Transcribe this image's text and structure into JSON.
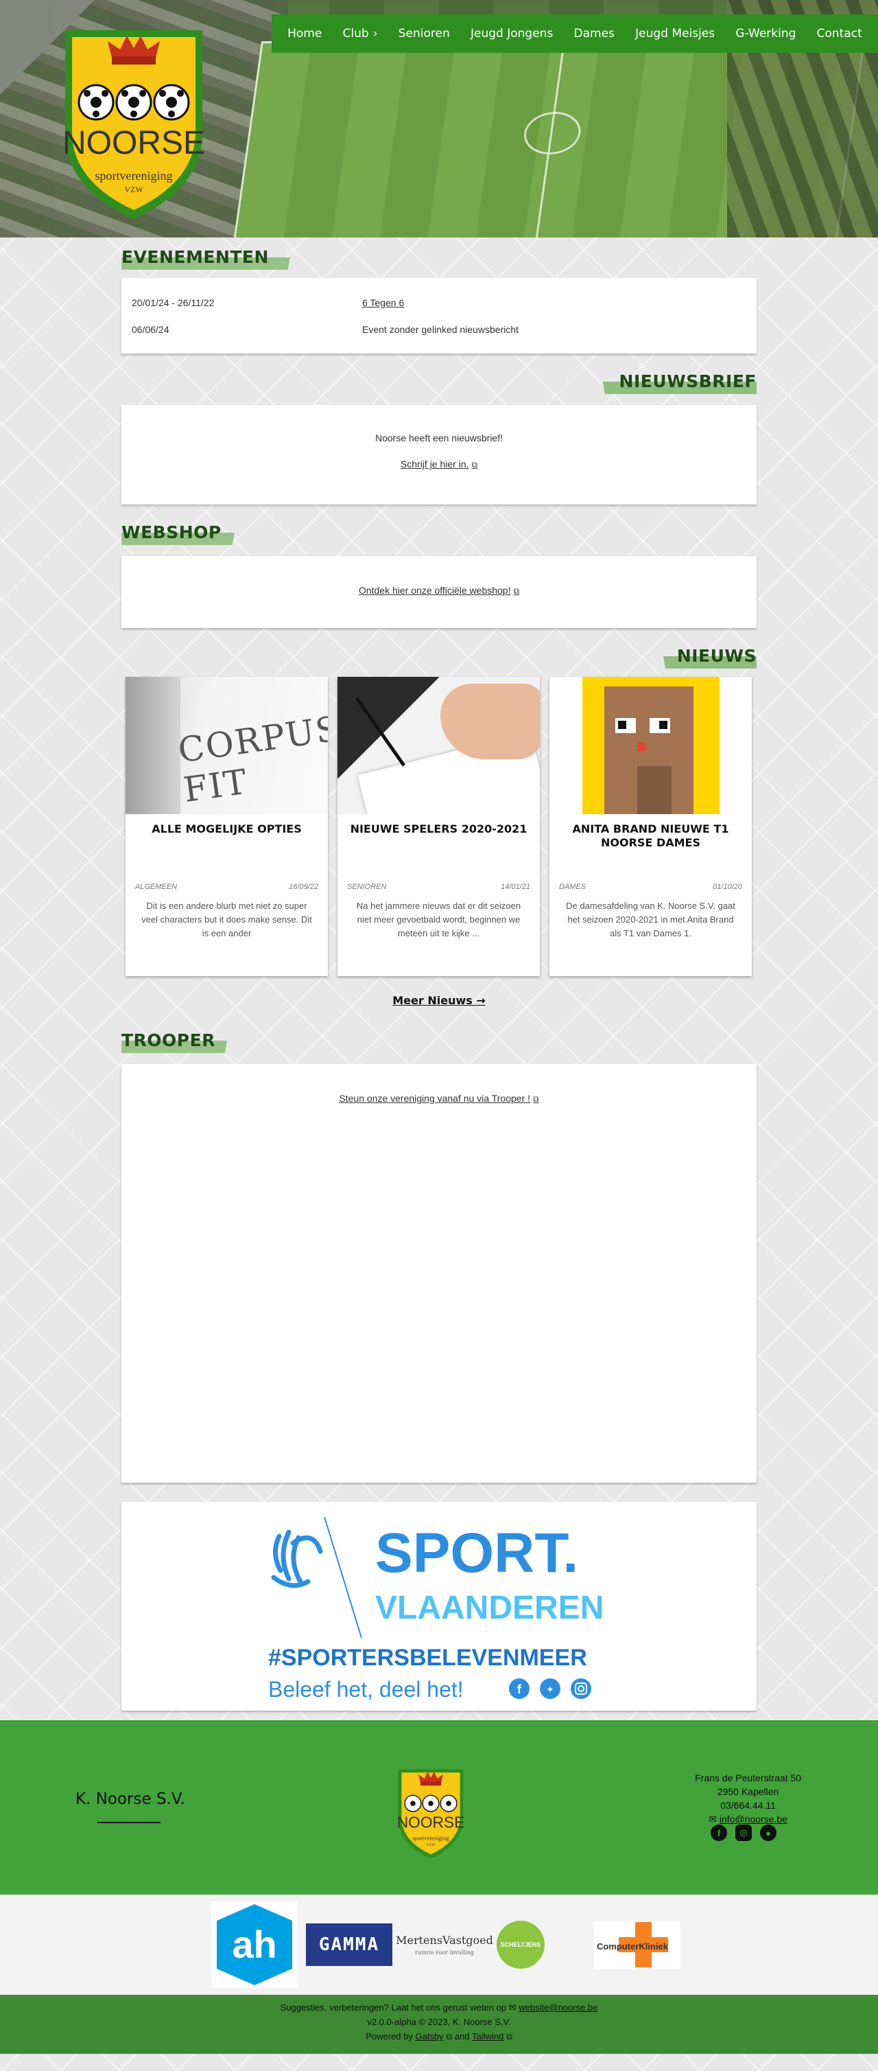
{
  "nav": {
    "items": [
      {
        "label": "Home"
      },
      {
        "label": "Club"
      },
      {
        "label": "Senioren"
      },
      {
        "label": "Jeugd Jongens"
      },
      {
        "label": "Dames"
      },
      {
        "label": "Jeugd Meisjes"
      },
      {
        "label": "G-Werking"
      },
      {
        "label": "Contact"
      }
    ]
  },
  "logo": {
    "name": "NOORSE",
    "subtitle": "sportvereniging",
    "vzw": "VZW"
  },
  "events": {
    "title": "EVENEMENTEN",
    "rows": [
      {
        "date": "20/01/24 - 26/11/22",
        "title": "6 Tegen 6"
      },
      {
        "date": "06/06/24",
        "title": "Event zonder gelinked nieuwsbericht"
      }
    ]
  },
  "newsletter": {
    "title": "NIEUWSBRIEF",
    "text": "Noorse heeft een nieuwsbrief!",
    "link": "Schrijf je hier in."
  },
  "webshop": {
    "title": "WEBSHOP",
    "link": "Ontdek hier onze officiële webshop!"
  },
  "news": {
    "title": "NIEUWS",
    "items": [
      {
        "image_text": "CORPUS FIT",
        "title": "ALLE MOGELIJKE OPTIES",
        "category": "ALGEMEEN",
        "date": "16/09/22",
        "blurb": "Dit is een andere blurb met niet zo super veel characters but it does make sense. Dit is een ander"
      },
      {
        "title": "NIEUWE SPELERS 2020-2021",
        "category": "SENIOREN",
        "date": "14/01/21",
        "blurb": "Na het jammere nieuws dat er dit seizoen niet meer gevoetbald wordt, beginnen we meteen uit te kijke ..."
      },
      {
        "title": "ANITA BRAND NIEUWE T1 NOORSE DAMES",
        "category": "DAMES",
        "date": "01/10/20",
        "blurb": "De damesafdeling van K. Noorse S.V. gaat het seizoen 2020-2021 in met Anita Brand als T1 van Dames 1."
      }
    ],
    "more": "Meer Nieuws"
  },
  "trooper": {
    "title": "TROOPER",
    "link": "Steun onze vereniging vanaf nu via Trooper !"
  },
  "sport_vlaanderen": {
    "line1": "SPORT.",
    "line2": "VLAANDEREN",
    "hashtag": "#SPORTERSBELEVENMEER",
    "slogan": "Beleef het, deel het!",
    "colors": {
      "blue": "#2d8ee0",
      "cyan": "#4fc3f7",
      "dark_blue": "#1e73c8"
    }
  },
  "footer": {
    "club_name": "K. Noorse S.V.",
    "address": "Frans de Peuterstraat 50",
    "city": "2950 Kapellen",
    "phone": "03/664.44.11",
    "email": "info@noorse.be",
    "social": [
      "facebook-icon",
      "instagram-icon",
      "github-icon"
    ]
  },
  "sponsors": {
    "gamma": "GAMMA",
    "mertens": "MertensVastgoed",
    "mertens_tag": "ruimte voor invulling",
    "scheltjens": "SCHELTJENS",
    "computer": "ComputerKliniek"
  },
  "bottom": {
    "suggestion": "Suggesties, verbeteringen? Laat het ons gerust weten op",
    "email": "website@noorse.be",
    "version": "v2.0.0-alpha © 2023, K. Noorse S.V.",
    "powered": "Powered by",
    "gatsby": "Gatsby",
    "and": "and",
    "tailwind": "Tailwind"
  },
  "colors": {
    "green": "#41a33a",
    "dark_green": "#2e8f1e",
    "title_green": "#1f4a18",
    "crest_yellow": "#f7c814"
  }
}
